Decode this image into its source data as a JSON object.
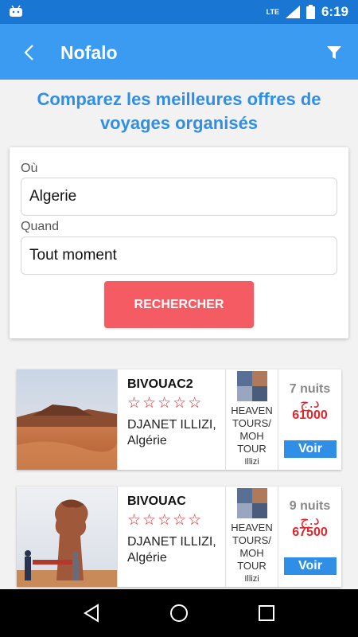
{
  "status_bar": {
    "network": "LTE",
    "time": "6:19",
    "icons": [
      "android-icon",
      "signal-icon",
      "battery-icon"
    ]
  },
  "app_bar": {
    "title": "Nofalo",
    "back_icon": "chevron-left-icon",
    "filter_icon": "filter-icon"
  },
  "headline": {
    "line1": "Comparez les meilleures offres de",
    "line2": "voyages organisés"
  },
  "search": {
    "where_label": "Où",
    "where_value": "Algerie",
    "when_label": "Quand",
    "when_value": "Tout moment",
    "button_label": "RECHERCHER"
  },
  "results": [
    {
      "name": "BIVOUAC2",
      "stars": "☆☆☆☆☆",
      "place_line1": "DJANET ILLIZI,",
      "place_line2": "Algérie",
      "agency_line1": "HEAVEN",
      "agency_line2": "TOURS/",
      "agency_line3": "MOH",
      "agency_line4": "TOUR",
      "agency_line5": "Illizi",
      "nights": "7 nuits",
      "currency": "د.ج",
      "price": "61000",
      "button_label": "Voir"
    },
    {
      "name": "BIVOUAC",
      "stars": "☆☆☆☆☆",
      "place_line1": "DJANET ILLIZI,",
      "place_line2": "Algérie",
      "agency_line1": "HEAVEN",
      "agency_line2": "TOURS/",
      "agency_line3": "MOH",
      "agency_line4": "TOUR",
      "agency_line5": "Illizi",
      "nights": "9 nuits",
      "currency": "د.ج",
      "price": "67500",
      "button_label": "Voir"
    }
  ],
  "nav_bar": {
    "icons": [
      "back-triangle-icon",
      "home-circle-icon",
      "recents-square-icon"
    ]
  },
  "colors": {
    "status_bar": "#1976d2",
    "app_bar": "#3a9bf0",
    "headline": "#2f8fe6",
    "search_button": "#f45b63",
    "price_red": "#e3262c",
    "voir_button": "#2f8fe6"
  }
}
